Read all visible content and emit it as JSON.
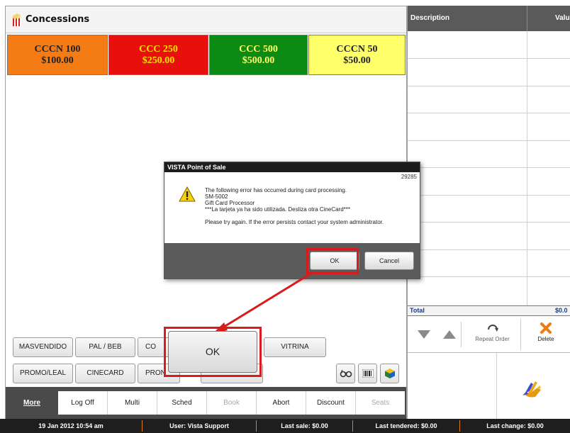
{
  "header": {
    "title": "Concessions",
    "icon": "popcorn-icon"
  },
  "tiles": [
    {
      "line1": "CCCN 100",
      "line2": "$100.00",
      "color": "#f57c14",
      "text_color": "#222222"
    },
    {
      "line1": "CCC 250",
      "line2": "$250.00",
      "color": "#e8100c",
      "text_color": "#ffe000"
    },
    {
      "line1": "CCC 500",
      "line2": "$500.00",
      "color": "#0b8a14",
      "text_color": "#ffff66"
    },
    {
      "line1": "CCCN 50",
      "line2": "$50.00",
      "color": "#ffff6a",
      "text_color": "#222222"
    }
  ],
  "categories": {
    "row1": [
      "MASVENDIDO",
      "PAL / BEB",
      "CO",
      "VITRINA"
    ],
    "row2": [
      "PROMO/LEAL",
      "CINECARD",
      "PRON"
    ]
  },
  "tools": [
    {
      "icon": "glasses-icon"
    },
    {
      "icon": "barcode-icon"
    },
    {
      "icon": "box-icon"
    }
  ],
  "nav": {
    "more": "More",
    "items": [
      "Log Off",
      "Multi",
      "Sched",
      "Book",
      "Abort",
      "Discount",
      "Seats"
    ]
  },
  "order": {
    "col_description": "Description",
    "col_value": "Valu",
    "total_label": "Total",
    "total_value": "$0.0"
  },
  "actions": {
    "down_icon": "chevron-down-icon",
    "up_icon": "chevron-up-icon",
    "repeat_label": "Repeat Order",
    "delete_label": "Delete"
  },
  "dialog": {
    "title": "VISTA  Point of Sale",
    "code": "29285",
    "lines": [
      "The following error has occurred during card processing.",
      "SM-5002",
      "Gift Card Processor",
      "***La tarjeta ya ha sido utilizada. Desliza otra CineCard***",
      "",
      "Please try again. If the error persists contact your system administrator."
    ],
    "ok_label": "OK",
    "cancel_label": "Cancel"
  },
  "callout": {
    "label": "OK"
  },
  "status": {
    "datetime": "19 Jan 2012 10:54 am",
    "user": "User: Vista Support",
    "last_sale": "Last sale: $0.00",
    "last_tendered": "Last tendered: $0.00",
    "last_change": "Last change: $0.00"
  },
  "colors": {
    "accent_red": "#d81c1c",
    "status_separator": "#e07a20"
  }
}
